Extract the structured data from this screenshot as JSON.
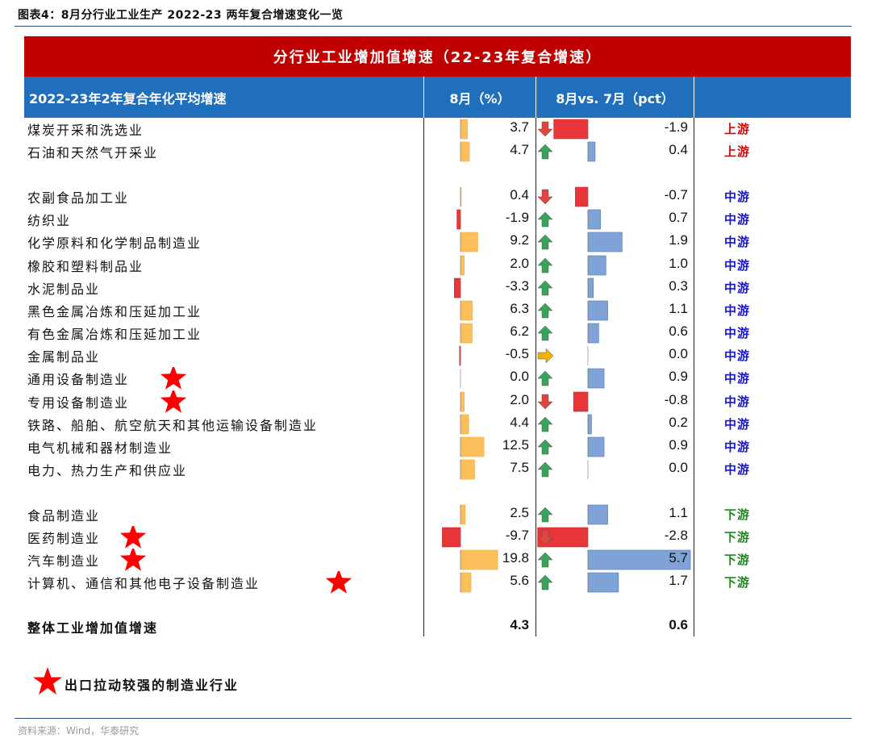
{
  "figure_title": "图表4：8月分行业工业生产 2022-23 两年复合增速变化一览",
  "header_title": "分行业工业增加值增速（22-23年复合增速）",
  "columns": {
    "col1": "2022-23年2年复合年化平均增速",
    "col2": "8月（%）",
    "col3": "8月vs. 7月（pct）"
  },
  "legend_text": "出口拉动较强的制造业行业",
  "source": "资料来源：Wind，华泰研究",
  "colors": {
    "red_header": "#c00000",
    "blue_header": "#1f6fbd",
    "up_text": "#e00000",
    "mid_text": "#1515d0",
    "down_text": "#1a8a1a",
    "pos_bar_aug": "#fbbf5c",
    "neg_bar": "#e8353a",
    "pos_bar_delta": "#7fa3d6",
    "arrow_up": "#3aa35a",
    "arrow_down": "#e0453e",
    "arrow_flat": "#f0b400",
    "star": "#ff0000"
  },
  "chart_data": {
    "type": "table",
    "rows": [
      {
        "name": "煤炭开采和洗选业",
        "aug": "3.7",
        "aug_v": 3.7,
        "delta": "-1.9",
        "delta_v": -1.9,
        "trend": "down",
        "stream": "上游",
        "star": false
      },
      {
        "name": "石油和天然气开采业",
        "aug": "4.7",
        "aug_v": 4.7,
        "delta": "0.4",
        "delta_v": 0.4,
        "trend": "up",
        "stream": "上游",
        "star": false
      },
      {
        "name": "农副食品加工业",
        "aug": "0.4",
        "aug_v": 0.4,
        "delta": "-0.7",
        "delta_v": -0.7,
        "trend": "down",
        "stream": "中游",
        "star": false
      },
      {
        "name": "纺织业",
        "aug": "-1.9",
        "aug_v": -1.9,
        "delta": "0.7",
        "delta_v": 0.7,
        "trend": "up",
        "stream": "中游",
        "star": false
      },
      {
        "name": "化学原料和化学制品制造业",
        "aug": "9.2",
        "aug_v": 9.2,
        "delta": "1.9",
        "delta_v": 1.9,
        "trend": "up",
        "stream": "中游",
        "star": false
      },
      {
        "name": "橡胶和塑料制品业",
        "aug": "2.0",
        "aug_v": 2.0,
        "delta": "1.0",
        "delta_v": 1.0,
        "trend": "up",
        "stream": "中游",
        "star": false
      },
      {
        "name": "水泥制品业",
        "aug": "-3.3",
        "aug_v": -3.3,
        "delta": "0.3",
        "delta_v": 0.3,
        "trend": "up",
        "stream": "中游",
        "star": false
      },
      {
        "name": "黑色金属冶炼和压延加工业",
        "aug": "6.3",
        "aug_v": 6.3,
        "delta": "1.1",
        "delta_v": 1.1,
        "trend": "up",
        "stream": "中游",
        "star": false
      },
      {
        "name": "有色金属冶炼和压延加工业",
        "aug": "6.2",
        "aug_v": 6.2,
        "delta": "0.6",
        "delta_v": 0.6,
        "trend": "up",
        "stream": "中游",
        "star": false
      },
      {
        "name": "金属制品业",
        "aug": "-0.5",
        "aug_v": -0.5,
        "delta": "0.0",
        "delta_v": 0.0,
        "trend": "flat",
        "stream": "中游",
        "star": false
      },
      {
        "name": "通用设备制造业",
        "aug": "0.0",
        "aug_v": 0.0,
        "delta": "0.9",
        "delta_v": 0.9,
        "trend": "up",
        "stream": "中游",
        "star": true
      },
      {
        "name": "专用设备制造业",
        "aug": "2.0",
        "aug_v": 2.0,
        "delta": "-0.8",
        "delta_v": -0.8,
        "trend": "down",
        "stream": "中游",
        "star": true
      },
      {
        "name": "铁路、船舶、航空航天和其他运输设备制造业",
        "aug": "4.4",
        "aug_v": 4.4,
        "delta": "0.2",
        "delta_v": 0.2,
        "trend": "up",
        "stream": "中游",
        "star": false
      },
      {
        "name": "电气机械和器材制造业",
        "aug": "12.5",
        "aug_v": 12.5,
        "delta": "0.9",
        "delta_v": 0.9,
        "trend": "up",
        "stream": "中游",
        "star": false
      },
      {
        "name": "电力、热力生产和供应业",
        "aug": "7.5",
        "aug_v": 7.5,
        "delta": "0.0",
        "delta_v": 0.0,
        "trend": "up",
        "stream": "中游",
        "star": false
      },
      {
        "name": "食品制造业",
        "aug": "2.5",
        "aug_v": 2.5,
        "delta": "1.1",
        "delta_v": 1.1,
        "trend": "up",
        "stream": "下游",
        "star": false
      },
      {
        "name": "医药制造业",
        "aug": "-9.7",
        "aug_v": -9.7,
        "delta": "-2.8",
        "delta_v": -2.8,
        "trend": "down",
        "stream": "下游",
        "star": true
      },
      {
        "name": "汽车制造业",
        "aug": "19.8",
        "aug_v": 19.8,
        "delta": "5.7",
        "delta_v": 5.7,
        "trend": "up",
        "stream": "下游",
        "star": true
      },
      {
        "name": "计算机、通信和其他电子设备制造业",
        "aug": "5.6",
        "aug_v": 5.6,
        "delta": "1.7",
        "delta_v": 1.7,
        "trend": "up",
        "stream": "下游",
        "star": true
      }
    ],
    "total": {
      "name": "整体工业增加值增速",
      "aug": "4.3",
      "delta": "0.6"
    }
  }
}
